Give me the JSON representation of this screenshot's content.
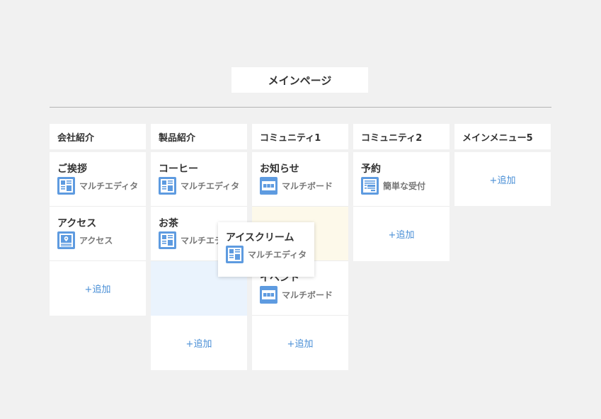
{
  "page": {
    "title": "メインページ"
  },
  "colors": {
    "accent": "#5e9be0",
    "link": "#4a8fd6",
    "drop_highlight_yellow": "#fdf9ea",
    "drop_highlight_blue": "#eaf3fd"
  },
  "columns": [
    {
      "header": "会社紹介",
      "cards": [
        {
          "title": "ご挨拶",
          "type": "マルチエディタ",
          "icon": "multi-editor-icon"
        },
        {
          "title": "アクセス",
          "type": "アクセス",
          "icon": "map-pin-icon"
        }
      ],
      "add_label": "+追加"
    },
    {
      "header": "製品紹介",
      "cards": [
        {
          "title": "コーヒー",
          "type": "マルチエディタ",
          "icon": "multi-editor-icon"
        },
        {
          "title": "お茶",
          "type": "マルチエディタ",
          "icon": "multi-editor-icon"
        }
      ],
      "add_label": "+追加"
    },
    {
      "header": "コミュニティ1",
      "cards": [
        {
          "title": "お知らせ",
          "type": "マルチボード",
          "icon": "multi-board-icon"
        },
        {
          "title": "イベント",
          "type": "マルチボード",
          "icon": "multi-board-icon"
        }
      ],
      "add_label": "+追加"
    },
    {
      "header": "コミュニティ2",
      "cards": [
        {
          "title": "予約",
          "type": "簡単な受付",
          "icon": "form-icon"
        }
      ],
      "add_label": "+追加"
    },
    {
      "header": "メインメニュー5",
      "cards": [],
      "add_label": "+追加"
    }
  ],
  "dragging": {
    "title": "アイスクリーム",
    "type": "マルチエディタ",
    "icon": "multi-editor-icon"
  }
}
